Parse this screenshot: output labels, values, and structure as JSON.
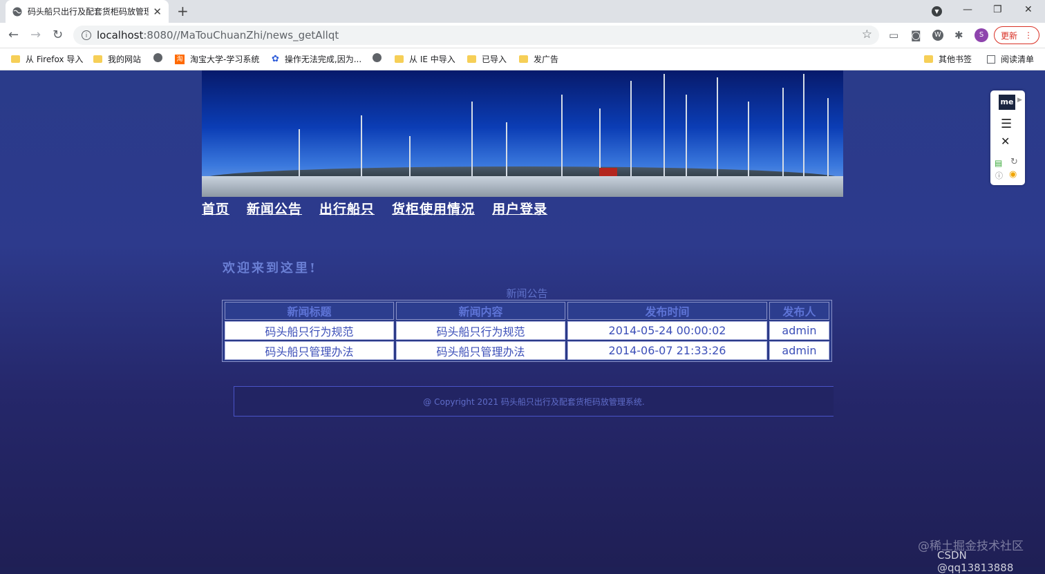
{
  "browser": {
    "tab_title": "码头船只出行及配套货柜码放管理",
    "tab_close": "✕",
    "new_tab": "+",
    "url_host": "localhost",
    "url_rest": ":8080//MaTouChuanZhi/news_getAllqt",
    "update_label": "更新",
    "avatar_letter": "S",
    "win_minimize": "—",
    "win_restore": "❐",
    "win_close": "✕",
    "back": "←",
    "forward": "→",
    "reload": "↻",
    "star": "☆"
  },
  "bookmarks": {
    "items": [
      {
        "label": "从 Firefox 导入",
        "icon": "folder-icon"
      },
      {
        "label": "我的网站",
        "icon": "folder-icon"
      },
      {
        "label": "",
        "icon": "globe-icon"
      },
      {
        "label": "淘宝大学-学习系统",
        "icon": "taobao-icon"
      },
      {
        "label": "操作无法完成,因为...",
        "icon": "baidu-paw-icon"
      },
      {
        "label": "",
        "icon": "globe-icon"
      },
      {
        "label": "从 IE 中导入",
        "icon": "folder-icon"
      },
      {
        "label": "已导入",
        "icon": "folder-icon"
      },
      {
        "label": "发广告",
        "icon": "folder-icon"
      }
    ],
    "other": "其他书签",
    "reading_list": "阅读清单"
  },
  "site": {
    "nav": [
      "首页",
      "新闻公告",
      "出行船只",
      "货柜使用情况",
      "用户登录"
    ],
    "welcome": "欢迎来到这里!",
    "table_caption": "新闻公告",
    "columns": [
      "新闻标题",
      "新闻内容",
      "发布时间",
      "发布人"
    ],
    "rows": [
      [
        "码头船只行为规范",
        "码头船只行为规范",
        "2014-05-24 00:00:02",
        "admin"
      ],
      [
        "码头船只管理办法",
        "码头船只管理办法",
        "2014-06-07 21:33:26",
        "admin"
      ]
    ],
    "footer": "@ Copyright 2021 码头船只出行及配套货柜码放管理系统."
  },
  "extension_panel": {
    "logo": "me"
  },
  "watermark": {
    "line1": "@稀土掘金技术社区",
    "line2": "CSDN @qq13813888"
  }
}
